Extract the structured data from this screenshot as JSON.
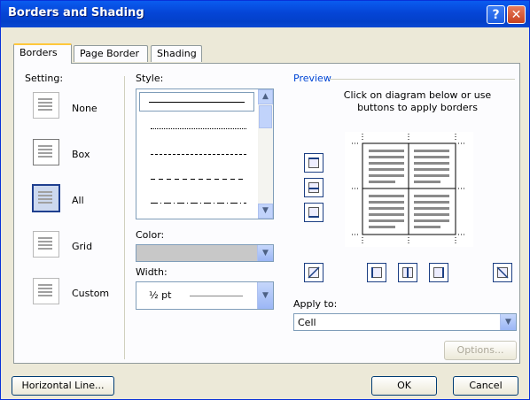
{
  "window": {
    "title": "Borders and Shading"
  },
  "tabs": [
    {
      "label": "Borders"
    },
    {
      "label": "Page Border"
    },
    {
      "label": "Shading"
    }
  ],
  "setting": {
    "label": "Setting:",
    "options": [
      {
        "label": "None",
        "icon": "setting-none-icon"
      },
      {
        "label": "Box",
        "icon": "setting-box-icon"
      },
      {
        "label": "All",
        "icon": "setting-all-icon",
        "selected": true
      },
      {
        "label": "Grid",
        "icon": "setting-grid-icon"
      },
      {
        "label": "Custom",
        "icon": "setting-custom-icon"
      }
    ]
  },
  "style": {
    "label": "Style:",
    "items": [
      "solid",
      "dotted",
      "dashed",
      "dash-dot-dense",
      "dash-dot"
    ]
  },
  "color": {
    "label": "Color:",
    "value": ""
  },
  "width": {
    "label": "Width:",
    "value": "½ pt"
  },
  "preview": {
    "label": "Preview",
    "instructions": "Click on diagram below or use buttons to apply borders"
  },
  "apply_to": {
    "label": "Apply to:",
    "value": "Cell"
  },
  "buttons": {
    "options": "Options...",
    "horizontal_line": "Horizontal Line...",
    "ok": "OK",
    "cancel": "Cancel"
  },
  "colors": {
    "accent": "#0a5cf0",
    "tab_highlight": "#ffc83c",
    "selection": "#1f3f8f"
  }
}
